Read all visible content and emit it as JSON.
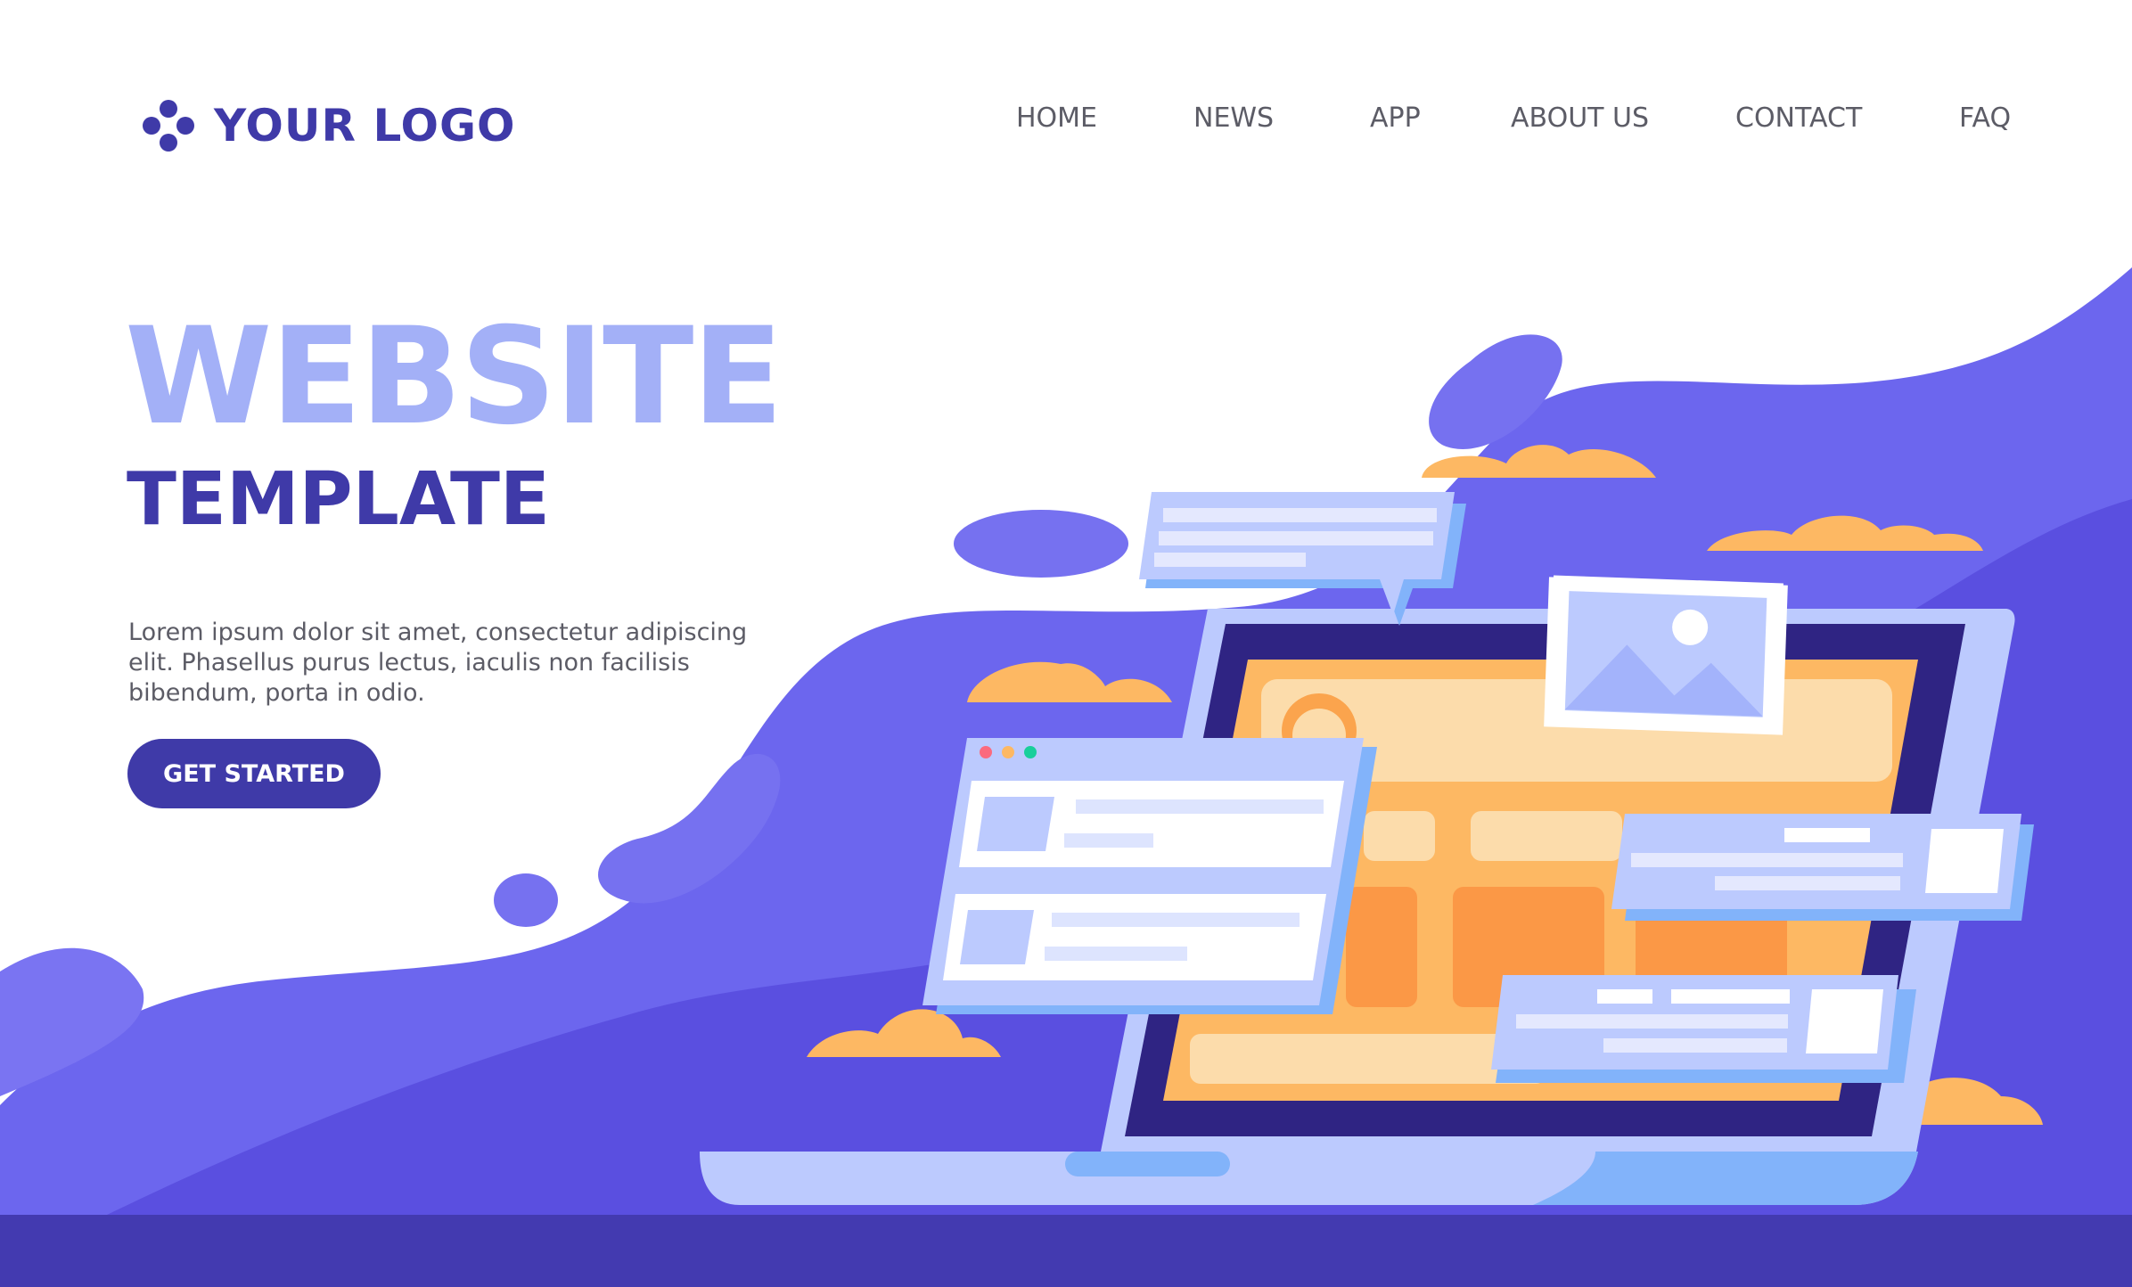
{
  "header": {
    "logo_text": "YOUR LOGO",
    "logo_icon": "four-dot-logo-icon",
    "nav": [
      "HOME",
      "NEWS",
      "APP",
      "ABOUT US",
      "CONTACT",
      "FAQ"
    ]
  },
  "hero": {
    "title": "WEBSITE",
    "subtitle": "TEMPLATE",
    "description": "Lorem ipsum dolor sit amet, consectetur adipiscing elit. Phasellus purus lectus, iaculis non facilisis bibendum, porta in odio.",
    "cta_label": "GET STARTED"
  },
  "colors": {
    "brand_dark": "#3f3aa8",
    "brand_light": "#a3b0f7",
    "wave": "#6a63ee",
    "accent_orange": "#fdb863"
  }
}
